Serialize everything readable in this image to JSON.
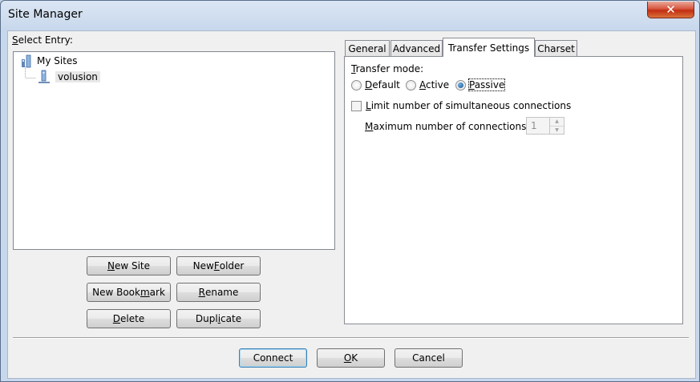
{
  "window": {
    "title": "Site Manager",
    "close_label": "✕",
    "accent_color": "#c42e12"
  },
  "left": {
    "select_entry_accel": "S",
    "select_entry_rest": "elect Entry:",
    "tree": {
      "root_label": "My Sites",
      "child_label": "volusion"
    }
  },
  "buttons": {
    "new_site": {
      "a": "N",
      "b": "ew Site"
    },
    "new_folder": {
      "a": "New ",
      "u": "F",
      "b": "older"
    },
    "new_bookmark": {
      "a": "New Book",
      "u": "m",
      "b": "ark"
    },
    "rename": {
      "u": "R",
      "b": "ename"
    },
    "delete": {
      "u": "D",
      "b": "elete"
    },
    "duplicate": {
      "a": "Dupl",
      "u": "i",
      "b": "cate"
    }
  },
  "tabs": {
    "general": "General",
    "advanced": "Advanced",
    "transfer_settings": "Transfer Settings",
    "charset": "Charset",
    "active_tab": "Transfer Settings"
  },
  "transfer": {
    "mode_label": {
      "u": "T",
      "b": "ransfer mode:"
    },
    "options": {
      "default": {
        "u": "D",
        "b": "efault"
      },
      "active": {
        "u": "A",
        "b": "ctive"
      },
      "passive": {
        "u": "P",
        "b": "assive"
      }
    },
    "selected_mode": "Passive",
    "limit_connections": {
      "u": "L",
      "b": "imit number of simultaneous connections",
      "checked": false
    },
    "max_connections_label": {
      "u": "M",
      "b": "aximum number of connections:"
    },
    "max_connections_value": "1"
  },
  "footer": {
    "connect": "Connect",
    "ok": {
      "u": "O",
      "b": "K"
    },
    "cancel": "Cancel"
  }
}
